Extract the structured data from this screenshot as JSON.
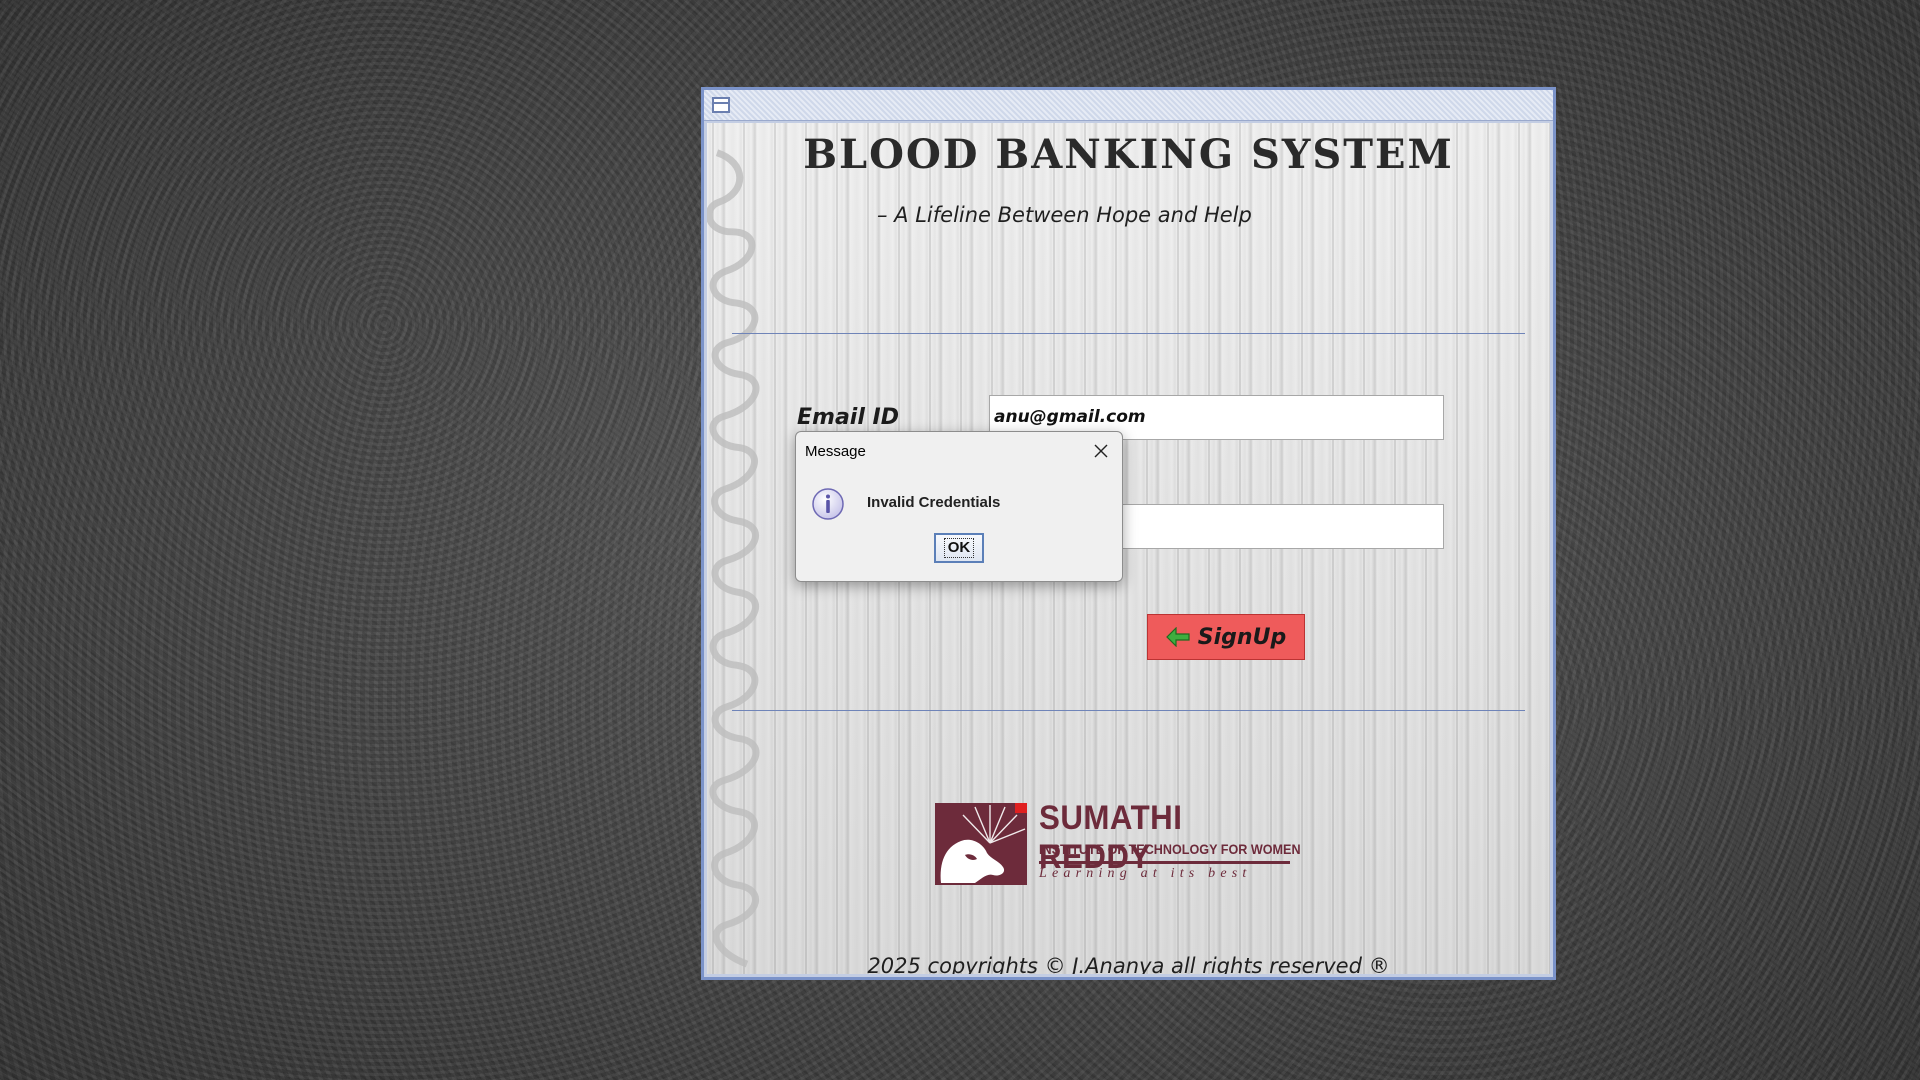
{
  "app": {
    "title": "BLOOD  BANKING SYSTEM",
    "tagline": "– A Lifeline Between Hope and Help"
  },
  "form": {
    "email_label": "Email ID",
    "email_value": "anu@gmail.com",
    "password_value": "",
    "signup_label": "SignUp"
  },
  "logo": {
    "name": "SUMATHI REDDY",
    "subtitle": "INSTITUTE OF TECHNOLOGY FOR WOMEN",
    "tagline": "Learning at its best"
  },
  "footer": {
    "copyright": "2025 copyrights © J.Ananya all rights reserved ®"
  },
  "dialog": {
    "title": "Message",
    "message": "Invalid Credentials",
    "ok_label": "OK",
    "icon": "info-icon"
  },
  "colors": {
    "window_border": "#7b93c9",
    "signup_button": "#ef5b5b",
    "logo_maroon": "#6d2b3b",
    "ok_button_border": "#5b7fb8"
  }
}
